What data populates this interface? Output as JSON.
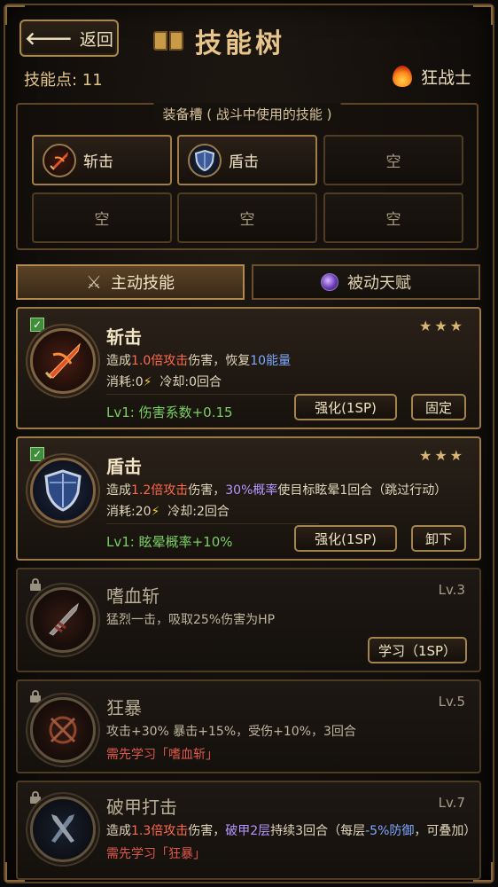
{
  "header": {
    "back_label": "返回",
    "title": "技能树",
    "skill_points_label": "技能点: 11",
    "class_name": "狂战士"
  },
  "equip": {
    "title": "装备槽 ( 战斗中使用的技能 )",
    "slots": [
      {
        "label": "斩击",
        "icon": "slash-skill-icon",
        "filled": true
      },
      {
        "label": "盾击",
        "icon": "shield-skill-icon",
        "filled": true
      },
      {
        "label": "空",
        "filled": false
      },
      {
        "label": "空",
        "filled": false
      },
      {
        "label": "空",
        "filled": false
      },
      {
        "label": "空",
        "filled": false
      }
    ]
  },
  "tabs": [
    {
      "label": "主动技能",
      "active": true,
      "icon": "crossed-swords-icon"
    },
    {
      "label": "被动天赋",
      "active": false,
      "icon": "purple-orb-icon"
    }
  ],
  "skills": [
    {
      "name": "斩击",
      "equipped": true,
      "stars": "★★★",
      "desc": {
        "p1": "造成",
        "v1": "1.0倍攻击",
        "p2": "伤害，恢复",
        "v2": "10能量",
        "p3": ""
      },
      "cost_label": "消耗:0",
      "cooldown_label": "冷却:0回合",
      "level_text": "Lv1: 伤害系数+0.15",
      "upgrade_label": "强化(1SP)",
      "action_label": "固定"
    },
    {
      "name": "盾击",
      "equipped": true,
      "stars": "★★★",
      "desc": {
        "p1": "造成",
        "v1": "1.2倍攻击",
        "p2": "伤害，",
        "v2": "30%概率",
        "p3": "使目标眩晕1回合（跳过行动）"
      },
      "cost_label": "消耗:20",
      "cooldown_label": "冷却:2回合",
      "level_text": "Lv1: 眩晕概率+10%",
      "upgrade_label": "强化(1SP)",
      "action_label": "卸下"
    },
    {
      "name": "嗜血斩",
      "locked": true,
      "level_req": "Lv.3",
      "desc_plain": "猛烈一击，吸取25%伤害为HP",
      "learn_label": "学习（1SP）"
    },
    {
      "name": "狂暴",
      "locked": true,
      "level_req": "Lv.5",
      "desc_plain": "攻击+30% 暴击+15%，受伤+10%，3回合",
      "requirement": "需先学习「嗜血斩」"
    },
    {
      "name": "破甲打击",
      "locked": true,
      "level_req": "Lv.7",
      "desc": {
        "p1": "造成",
        "v1": "1.3倍攻击",
        "p2": "伤害，",
        "v2": "破甲2层",
        "p3": "持续3回合（每层",
        "v3": "-5%防御",
        "p4": "，可叠加）"
      },
      "requirement": "需先学习「狂暴」"
    }
  ],
  "colors": {
    "gold": "#d8b571",
    "damage_red": "#ff6a4c",
    "energy_blue": "#7fa8ff",
    "chance_purple": "#b696ff",
    "level_green": "#7bcf62",
    "requirement_red": "#e0584a"
  }
}
